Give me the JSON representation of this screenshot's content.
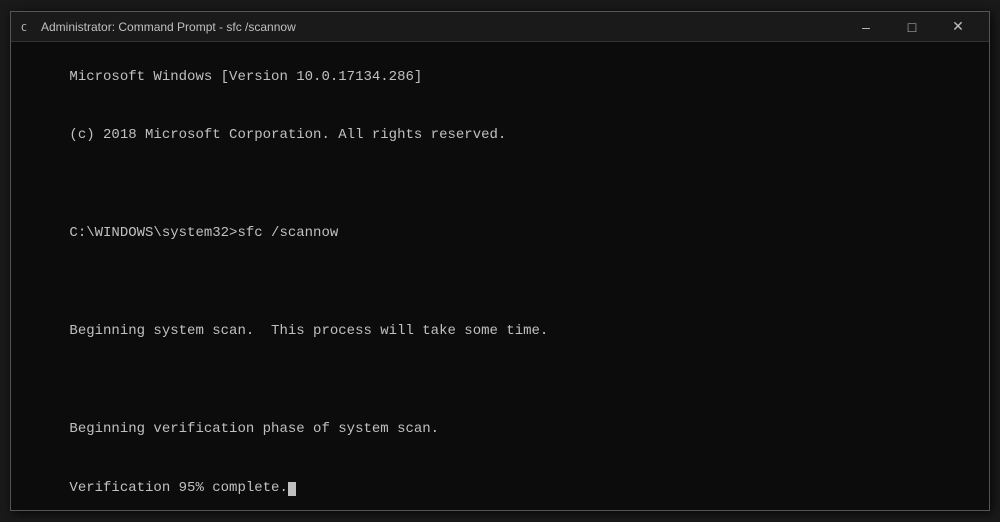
{
  "window": {
    "title": "Administrator: Command Prompt - sfc /scannow",
    "icon": "cmd-icon"
  },
  "titlebar": {
    "minimize_label": "–",
    "maximize_label": "□",
    "close_label": "✕"
  },
  "console": {
    "line1": "Microsoft Windows [Version 10.0.17134.286]",
    "line2": "(c) 2018 Microsoft Corporation. All rights reserved.",
    "line3": "",
    "line4": "C:\\WINDOWS\\system32>sfc /scannow",
    "line5": "",
    "line6": "Beginning system scan.  This process will take some time.",
    "line7": "",
    "line8": "Beginning verification phase of system scan.",
    "line9_prefix": "Verification 95% complete."
  }
}
